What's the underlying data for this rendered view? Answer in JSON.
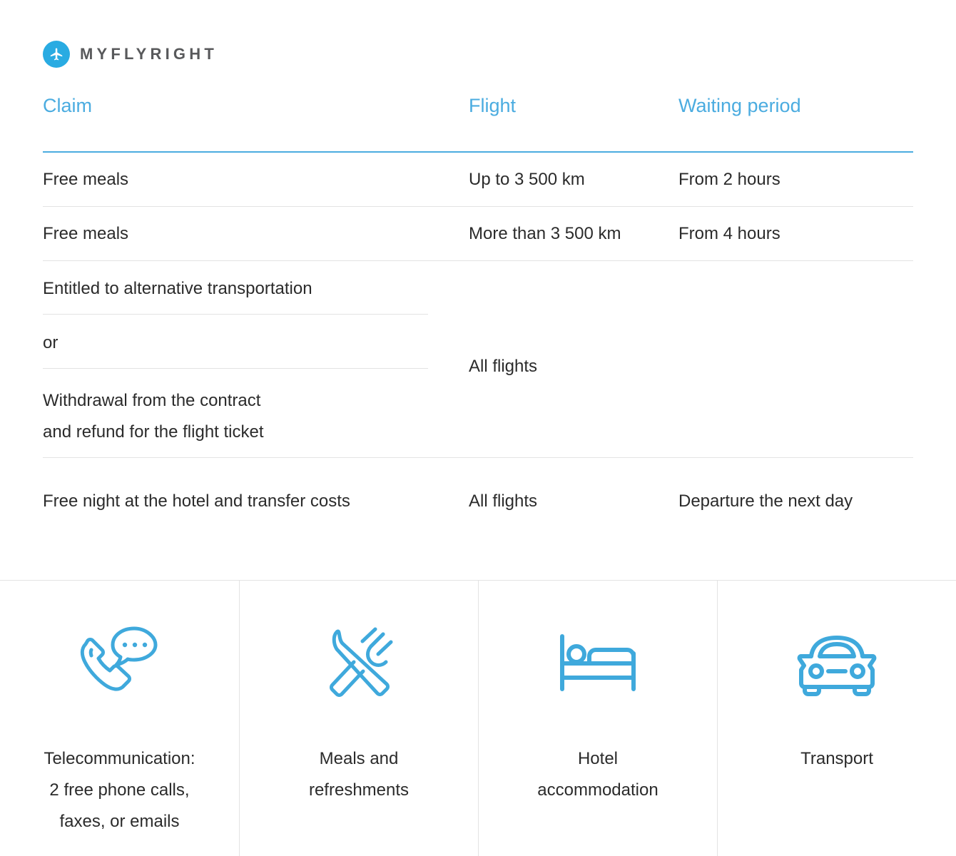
{
  "brand": {
    "name": "MYFLYRIGHT",
    "icon": "airplane-icon",
    "accent_color": "#29ABE2"
  },
  "table": {
    "accent_color": "#4BACE0",
    "rule_color": "#E3E3E3",
    "headers": {
      "claim": "Claim",
      "flight": "Flight",
      "waiting": "Waiting period"
    },
    "rows": [
      {
        "claim": "Free meals",
        "flight": "Up to 3 500 km",
        "waiting": "From 2 hours"
      },
      {
        "claim": "Free meals",
        "flight": "More than 3 500 km",
        "waiting": "From 4 hours"
      }
    ],
    "group_row": {
      "claims": [
        "Entitled to alternative transportation",
        "or",
        "Withdrawal from the contract\nand refund for the flight ticket"
      ],
      "flight": "All flights",
      "waiting": ""
    },
    "last_row": {
      "claim": "Free night at the hotel and transfer costs",
      "flight": "All flights",
      "waiting": "Departure the next day"
    }
  },
  "features": [
    {
      "icon": "phone-chat-icon",
      "label": "Telecommunication:\n2 free phone calls,\nfaxes, or emails"
    },
    {
      "icon": "cutlery-icon",
      "label": "Meals and\nrefreshments"
    },
    {
      "icon": "bed-icon",
      "label": "Hotel\naccommodation"
    },
    {
      "icon": "car-icon",
      "label": "Transport"
    }
  ]
}
